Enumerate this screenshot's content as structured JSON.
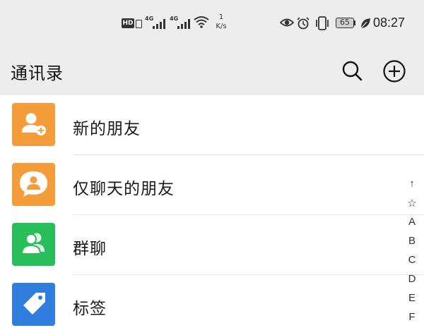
{
  "status_bar": {
    "hd_label": "HD",
    "signal1_label": "4G",
    "signal2_label": "4G",
    "speed_value": "1",
    "speed_unit": "K/s",
    "battery": "65",
    "time": "08:27"
  },
  "header": {
    "title": "通讯录",
    "search_icon": "search-icon",
    "add_icon": "add-circle-icon"
  },
  "colors": {
    "orange": "#f59c3b",
    "green": "#28bf5b",
    "blue": "#2f7ddc",
    "header_bg": "#ededed"
  },
  "list": {
    "items": [
      {
        "label": "新的朋友",
        "icon": "add-friend-icon"
      },
      {
        "label": "仅聊天的朋友",
        "icon": "chat-only-friend-icon"
      },
      {
        "label": "群聊",
        "icon": "group-chat-icon"
      },
      {
        "label": "标签",
        "icon": "tag-icon"
      }
    ]
  },
  "index_bar": {
    "letters": [
      "↑",
      "☆",
      "A",
      "B",
      "C",
      "D",
      "E",
      "F"
    ]
  }
}
